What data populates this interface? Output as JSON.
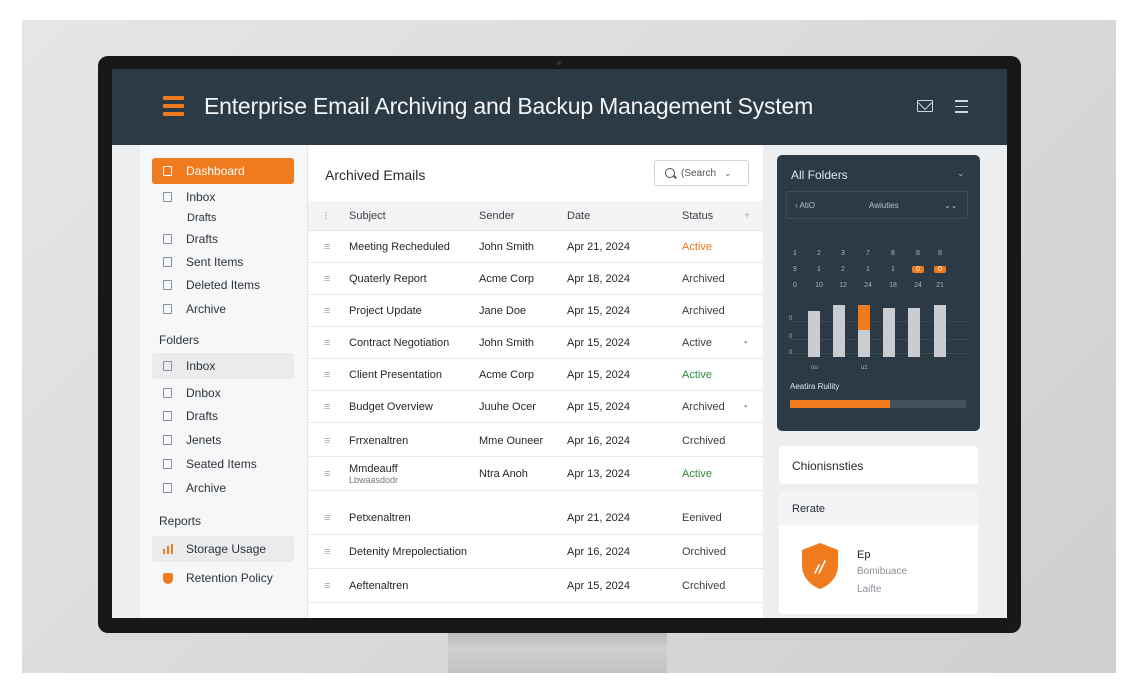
{
  "header": {
    "title": "Enterprise Email Archiving and Backup Management System",
    "icons": [
      "hamburger-menu-icon",
      "mail-icon",
      "list-icon"
    ]
  },
  "sidebar": {
    "nav": [
      {
        "label": "Dashboard",
        "active": true
      },
      {
        "label": "Inbox"
      },
      {
        "label": "Drafts"
      },
      {
        "label": "Sent Items"
      },
      {
        "label": "Deleted Items"
      },
      {
        "label": "Archive"
      }
    ],
    "drafts_sub": "Drafts",
    "folders_heading": "Folders",
    "folders": [
      {
        "label": "Inbox",
        "selected": true
      },
      {
        "label": "Dnbox"
      },
      {
        "label": "Drafts"
      },
      {
        "label": "Jenets"
      },
      {
        "label": "Seated Items"
      },
      {
        "label": "Archive"
      }
    ],
    "reports_heading": "Reports",
    "reports": [
      {
        "label": "Storage Usage",
        "icon": "bar-chart-icon"
      },
      {
        "label": "Retention Policy",
        "icon": "shield-icon"
      }
    ]
  },
  "main": {
    "title": "Archived Emails",
    "search_placeholder": "(Search",
    "columns": {
      "drag": "⁝",
      "subject": "Subject",
      "sender": "Sender",
      "date": "Date",
      "status": "Status",
      "more": "+"
    },
    "rows": [
      {
        "subject": "Meeting Recheduled",
        "sender": "John Smith",
        "date": "Apr 21, 2024",
        "status": "Active",
        "status_style": "active-o",
        "more": ""
      },
      {
        "subject": "Quaterly Report",
        "sender": "Acme Corp",
        "date": "Apr 18, 2024",
        "status": "Archived",
        "status_style": "arch",
        "more": ""
      },
      {
        "subject": "Project Update",
        "sender": "Jane Doe",
        "date": "Apr 15, 2024",
        "status": "Archived",
        "status_style": "arch",
        "more": ""
      },
      {
        "subject": "Contract Negotiation",
        "sender": "John Smith",
        "date": "Apr 15, 2024",
        "status": "Active",
        "status_style": "arch",
        "more": "•"
      },
      {
        "subject": "Client Presentation",
        "sender": "Acme Corp",
        "date": "Apr 15, 2024",
        "status": "Active",
        "status_style": "active-g",
        "more": ""
      },
      {
        "subject": "Budget Overview",
        "sender": "Juuhe Ocer",
        "date": "Apr 15, 2024",
        "status": "Archived",
        "status_style": "arch",
        "more": "•"
      },
      {
        "subject": "Frrxenaltren",
        "sender": "Mme Ouneer",
        "date": "Apr 16, 2024",
        "status": "Crchived",
        "status_style": "arch",
        "more": ""
      },
      {
        "subject": "Mmdeauff",
        "subject2": "Lbwaasdodr",
        "sender": "Ntra Anoh",
        "date": "Apr 13, 2024",
        "status": "Active",
        "status_style": "active-g",
        "more": ""
      },
      {
        "subject": "Petxenaltren",
        "sender": "",
        "date": "Apr 21, 2024",
        "status": "Eenived",
        "status_style": "arch",
        "more": ""
      },
      {
        "subject": "Detenity Mrepolectiation",
        "sender": "",
        "date": "Apr 16, 2024",
        "status": "Orchived",
        "status_style": "arch",
        "more": ""
      },
      {
        "subject": "Aeftenaltren",
        "sender": "",
        "date": "Apr 15, 2024",
        "status": "Crchived",
        "status_style": "arch",
        "more": ""
      }
    ]
  },
  "folders_card": {
    "title": "All Folders",
    "select_left": "‹ AtiO",
    "select_mid": "Awiuties",
    "select_right": "⌄⌄",
    "calendar_rows": [
      [
        "1",
        "2",
        "3",
        "7",
        "8",
        "8",
        "8"
      ],
      [
        "9",
        "1",
        "2",
        "1",
        "1",
        "0",
        "0"
      ],
      [
        "0",
        "10",
        "12",
        "24",
        "18",
        "24",
        "21"
      ]
    ],
    "calendar_highlights": [
      "1-5",
      "1-6"
    ],
    "y_labels": [
      "0",
      "0",
      "0"
    ],
    "x_labels": [
      "ou",
      "uz"
    ],
    "retention_label": "Aeatira Ruility",
    "retention_progress": 0.57
  },
  "chart_data": {
    "type": "bar",
    "series": [
      {
        "values": [
          46,
          52,
          52,
          49,
          49,
          52
        ],
        "highlight_index": 2,
        "highlight_value": 25
      }
    ],
    "ylim": [
      0,
      60
    ]
  },
  "card2": {
    "title": "Chionisnsties"
  },
  "card3": {
    "title": "Rerate",
    "line1": "Ep",
    "line2": "Bomibuace",
    "line3": "Laifte",
    "icon": "shield-icon"
  },
  "colors": {
    "accent": "#f07b1f",
    "header": "#2c3a45",
    "active_green": "#2e8b3e"
  }
}
